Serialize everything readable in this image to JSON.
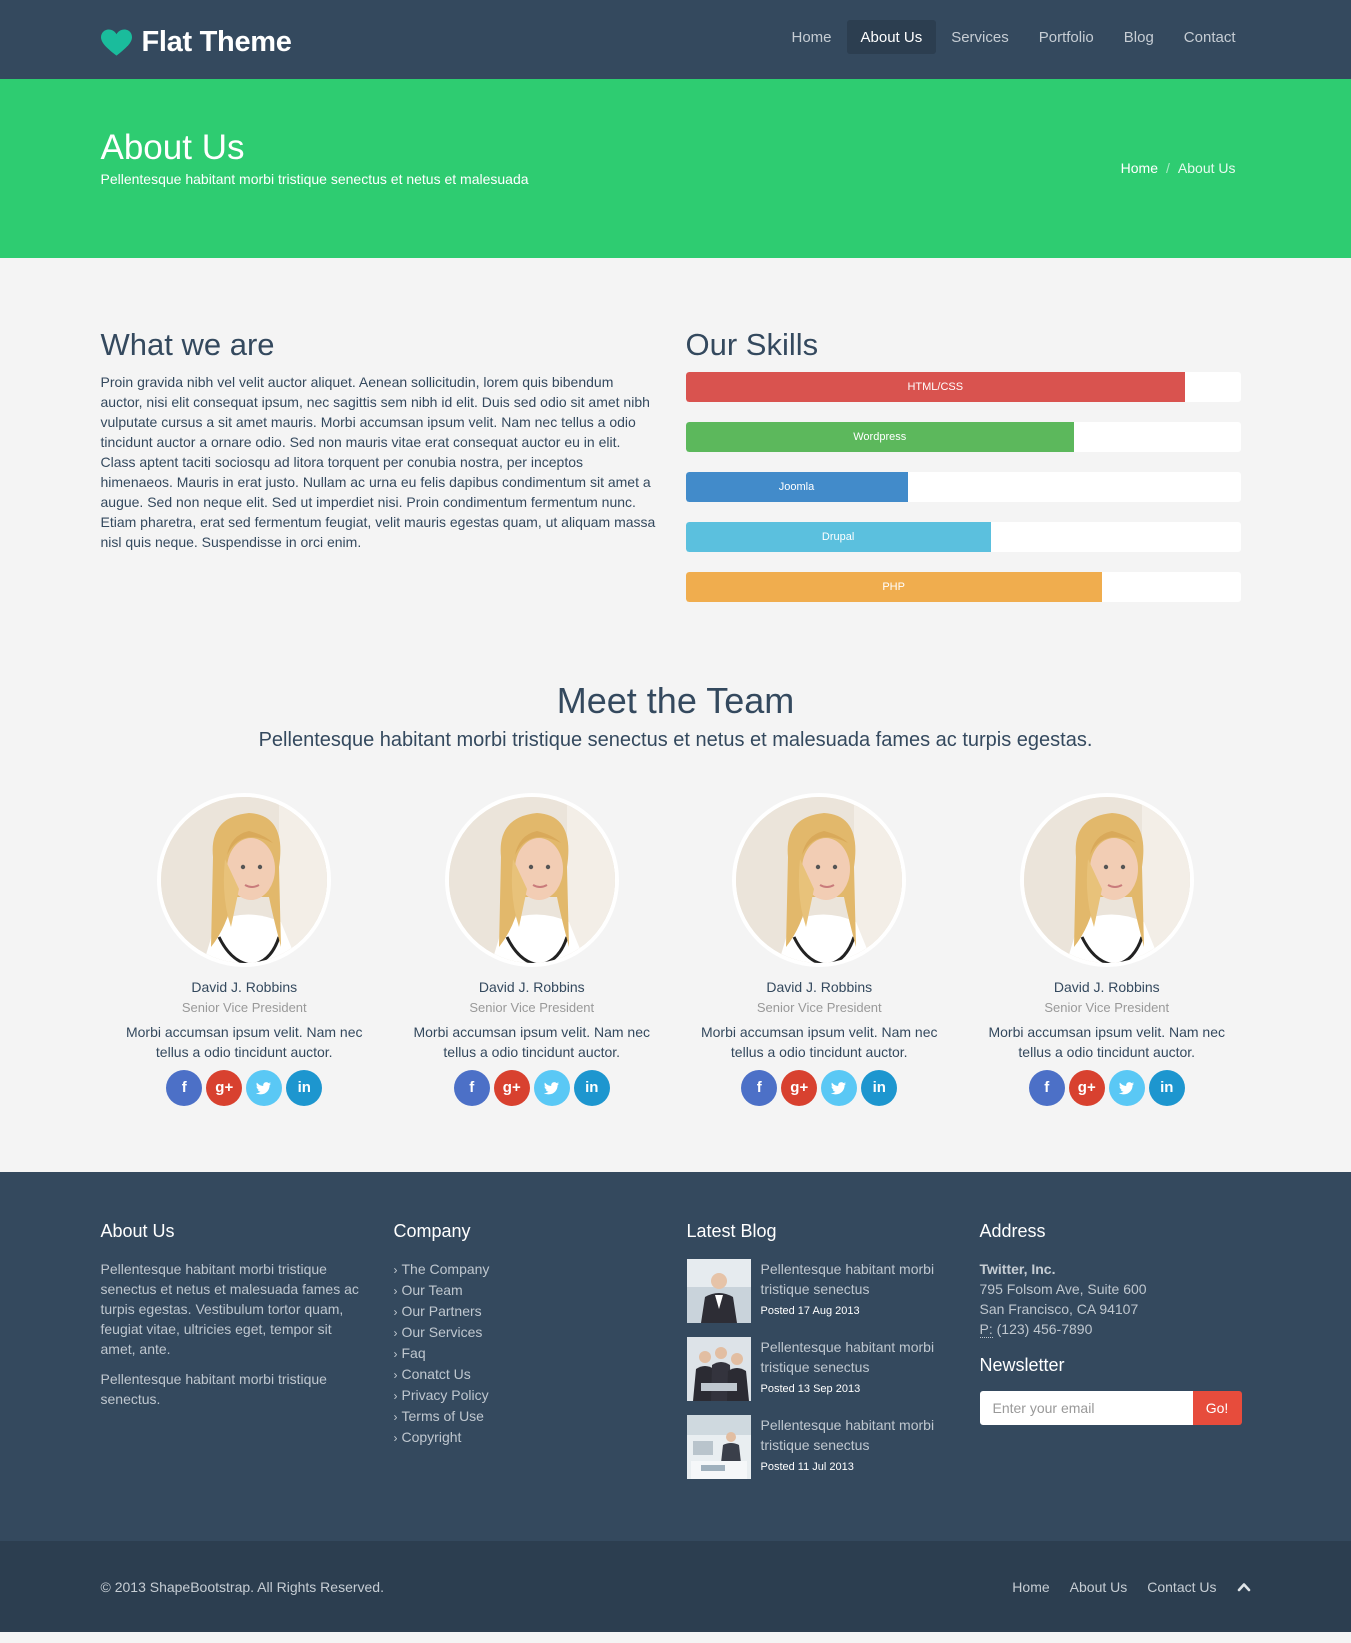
{
  "header": {
    "brand": "Flat Theme",
    "nav": [
      "Home",
      "About Us",
      "Services",
      "Portfolio",
      "Blog",
      "Contact"
    ],
    "active_nav": "About Us"
  },
  "title_band": {
    "title": "About Us",
    "subtitle": "Pellentesque habitant morbi tristique senectus et netus et malesuada",
    "breadcrumb_home": "Home",
    "breadcrumb_current": "About Us"
  },
  "about": {
    "heading": "What we are",
    "text": "Proin gravida nibh vel velit auctor aliquet. Aenean sollicitudin, lorem quis bibendum auctor, nisi elit consequat ipsum, nec sagittis sem nibh id elit. Duis sed odio sit amet nibh vulputate cursus a sit amet mauris. Morbi accumsan ipsum velit. Nam nec tellus a odio tincidunt auctor a ornare odio. Sed non mauris vitae erat consequat auctor eu in elit. Class aptent taciti sociosqu ad litora torquent per conubia nostra, per inceptos himenaeos. Mauris in erat justo. Nullam ac urna eu felis dapibus condimentum sit amet a augue. Sed non neque elit. Sed ut imperdiet nisi. Proin condimentum fermentum nunc. Etiam pharetra, erat sed fermentum feugiat, velit mauris egestas quam, ut aliquam massa nisl quis neque. Suspendisse in orci enim."
  },
  "skills": {
    "heading": "Our Skills",
    "items": [
      {
        "label": "HTML/CSS",
        "percent": 90,
        "color": "#d9534f"
      },
      {
        "label": "Wordpress",
        "percent": 70,
        "color": "#5cb85c"
      },
      {
        "label": "Joomla",
        "percent": 40,
        "color": "#428bca"
      },
      {
        "label": "Drupal",
        "percent": 55,
        "color": "#5bc0de"
      },
      {
        "label": "PHP",
        "percent": 75,
        "color": "#f0ad4e"
      }
    ]
  },
  "team": {
    "heading": "Meet the Team",
    "subtitle": "Pellentesque habitant morbi tristique senectus et netus et malesuada fames ac turpis egestas.",
    "members": [
      {
        "name": "David J. Robbins",
        "role": "Senior Vice President",
        "desc": "Morbi accumsan ipsum velit. Nam nec tellus a odio tincidunt auctor."
      },
      {
        "name": "David J. Robbins",
        "role": "Senior Vice President",
        "desc": "Morbi accumsan ipsum velit. Nam nec tellus a odio tincidunt auctor."
      },
      {
        "name": "David J. Robbins",
        "role": "Senior Vice President",
        "desc": "Morbi accumsan ipsum velit. Nam nec tellus a odio tincidunt auctor."
      },
      {
        "name": "David J. Robbins",
        "role": "Senior Vice President",
        "desc": "Morbi accumsan ipsum velit. Nam nec tellus a odio tincidunt auctor."
      }
    ],
    "social_icons": [
      "facebook-icon",
      "google-plus-icon",
      "twitter-icon",
      "linkedin-icon"
    ],
    "social_glyphs": [
      "f",
      "g+",
      "t",
      "in"
    ]
  },
  "footer": {
    "about_heading": "About Us",
    "about_p1": "Pellentesque habitant morbi tristique senectus et netus et malesuada fames ac turpis egestas. Vestibulum tortor quam, feugiat vitae, ultricies eget, tempor sit amet, ante.",
    "about_p2": "Pellentesque habitant morbi tristique senectus.",
    "company_heading": "Company",
    "company_links": [
      "The Company",
      "Our Team",
      "Our Partners",
      "Our Services",
      "Faq",
      "Conatct Us",
      "Privacy Policy",
      "Terms of Use",
      "Copyright"
    ],
    "blog_heading": "Latest Blog",
    "blog_posts": [
      {
        "title": "Pellentesque habitant morbi tristique senectus",
        "date": "Posted 17 Aug 2013"
      },
      {
        "title": "Pellentesque habitant morbi tristique senectus",
        "date": "Posted 13 Sep 2013"
      },
      {
        "title": "Pellentesque habitant morbi tristique senectus",
        "date": "Posted 11 Jul 2013"
      }
    ],
    "address_heading": "Address",
    "company_name": "Twitter, Inc.",
    "street": "795 Folsom Ave, Suite 600",
    "city": "San Francisco, CA 94107",
    "phone_label": "P:",
    "phone": "(123) 456-7890",
    "newsletter_heading": "Newsletter",
    "email_placeholder": "Enter your email",
    "go_label": "Go!"
  },
  "bottom": {
    "copyright": "© 2013 ShapeBootstrap. All Rights Reserved.",
    "links": [
      "Home",
      "About Us",
      "Contact Us"
    ]
  },
  "colors": {
    "navy": "#34495e",
    "green": "#2ecc71",
    "red": "#e74c3c"
  }
}
